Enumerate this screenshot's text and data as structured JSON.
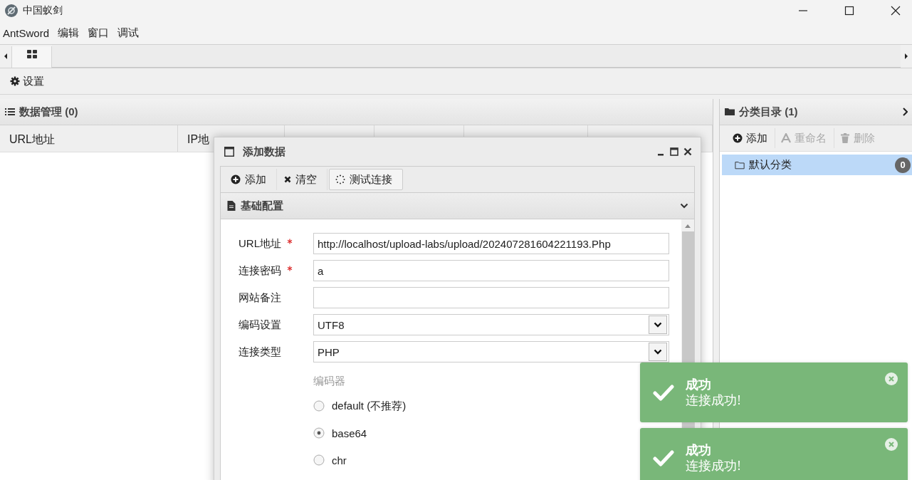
{
  "window": {
    "title": "中国蚁剑"
  },
  "menu": [
    {
      "label": "AntSword"
    },
    {
      "label": "编辑"
    },
    {
      "label": "窗口"
    },
    {
      "label": "调试"
    }
  ],
  "toolbar": {
    "settings": "设置"
  },
  "data_panel": {
    "title": "数据管理 (0)",
    "columns": [
      "URL地址",
      "IP地"
    ]
  },
  "category_panel": {
    "title": "分类目录 (1)",
    "actions": [
      {
        "label": "添加",
        "kind": "add",
        "disabled": false
      },
      {
        "label": "重命名",
        "kind": "rename",
        "disabled": true
      },
      {
        "label": "删除",
        "kind": "delete",
        "disabled": true
      }
    ],
    "items": [
      {
        "label": "默认分类",
        "count": "0",
        "selected": true
      }
    ]
  },
  "dialog": {
    "title": "添加数据",
    "actions": [
      {
        "label": "添加",
        "kind": "add"
      },
      {
        "label": "清空",
        "kind": "clear"
      },
      {
        "label": "测试连接",
        "kind": "test"
      }
    ],
    "section": "基础配置",
    "fields": [
      {
        "label": "URL地址",
        "required": true,
        "kind": "text",
        "value": "http://localhost/upload-labs/upload/202407281604221193.Php"
      },
      {
        "label": "连接密码",
        "required": true,
        "kind": "text",
        "value": "a"
      },
      {
        "label": "网站备注",
        "required": false,
        "kind": "text"
      },
      {
        "label": "编码设置",
        "required": false,
        "kind": "select",
        "value": "UTF8"
      },
      {
        "label": "连接类型",
        "required": false,
        "kind": "select",
        "value": "PHP"
      }
    ],
    "encoder": {
      "label": "编码器",
      "options": [
        {
          "label": "default (不推荐)",
          "selected": false
        },
        {
          "label": "base64",
          "selected": true
        },
        {
          "label": "chr",
          "selected": false
        }
      ]
    }
  },
  "toasts": [
    {
      "title": "成功",
      "message": "连接成功!"
    },
    {
      "title": "成功",
      "message": "连接成功!"
    }
  ]
}
